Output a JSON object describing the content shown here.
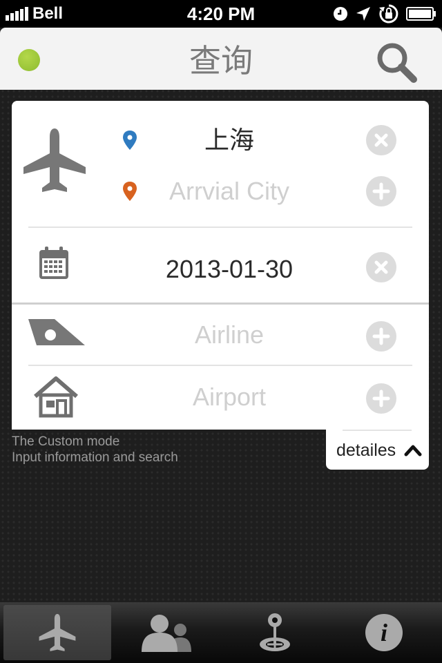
{
  "status_bar": {
    "carrier": "Bell",
    "time": "4:20 PM",
    "icons": [
      "signal-bars-icon",
      "clock-icon",
      "location-arrow-icon",
      "rotation-lock-icon",
      "battery-icon"
    ]
  },
  "nav": {
    "title": "查询",
    "status_indicator_color": "#8dbb2f",
    "search_icon": "search-icon"
  },
  "form": {
    "departure_city": "上海",
    "departure_pin_color": "#2f7bc0",
    "arrival_city_placeholder": "Arrvial City",
    "arrival_pin_color": "#d8621f",
    "date": "2013-01-30",
    "airline_placeholder": "Airline",
    "airport_placeholder": "Airport"
  },
  "hint": {
    "line1": "The Custom mode",
    "line2": "Input information and search"
  },
  "details": {
    "label": "detailes"
  },
  "tabbar": {
    "tabs": [
      {
        "icon": "airplane-icon",
        "active": true
      },
      {
        "icon": "people-icon",
        "active": false
      },
      {
        "icon": "map-pin-icon",
        "active": false
      },
      {
        "icon": "info-icon",
        "active": false
      }
    ]
  }
}
